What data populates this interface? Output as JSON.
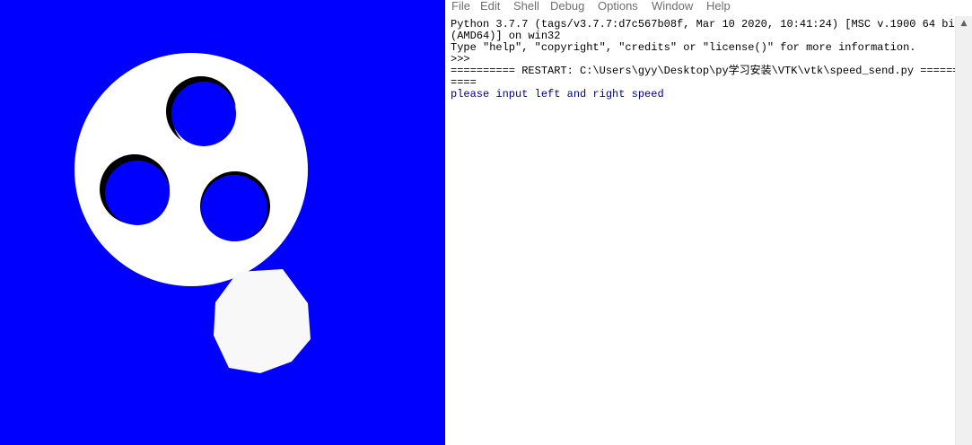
{
  "vtk_render_window": {
    "background_color": "#0000ff",
    "shapes": [
      "white-disk-with-three-holes",
      "white-decagon"
    ]
  },
  "idle_shell": {
    "menu": {
      "items": [
        "File",
        "Edit",
        "Shell",
        "Debug",
        "Options",
        "Window",
        "Help"
      ]
    },
    "text_lines": [
      "Python 3.7.7 (tags/v3.7.7:d7c567b08f, Mar 10 2020, 10:41:24) [MSC v.1900 64 bit",
      "(AMD64)] on win32",
      "Type \"help\", \"copyright\", \"credits\" or \"license()\" for more information.",
      ">>> ",
      "========== RESTART: C:\\Users\\gyy\\Desktop\\py学习安装\\VTK\\vtk\\speed_send.py ======",
      "===="
    ],
    "input_prompt_line": "please input left and right speed",
    "colors": {
      "output_text": "#000000",
      "input_prompt_text": "#00008f"
    },
    "scrollbar": {
      "up_arrow_icon": "▲"
    }
  }
}
